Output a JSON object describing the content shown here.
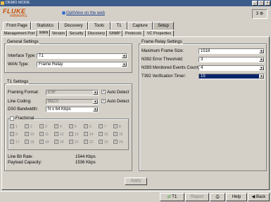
{
  "window": {
    "title": "DEMO MODE"
  },
  "header": {
    "brand_line1": "FLUKE",
    "brand_line2": "networks.",
    "web_link": "OptiView on the web",
    "counter": "3"
  },
  "main_tabs": [
    "Front Page",
    "Statistics",
    "Discovery",
    "Tools",
    "T1",
    "Capture",
    "Setup"
  ],
  "sub_tabs": [
    "Management Port",
    "WAN",
    "Version",
    "Security",
    "Discovery",
    "SNMP",
    "Protocols",
    "VC Properties"
  ],
  "general_settings": {
    "title": "General Settings",
    "interface_type_label": "Interface Type:",
    "interface_type_value": "T1",
    "wan_type_label": "WAN Type:",
    "wan_type_value": "Frame Relay"
  },
  "t1_settings": {
    "title": "T1 Settings",
    "framing_format_label": "Framing Format:",
    "framing_format_value": "ESF",
    "line_coding_label": "Line Coding:",
    "line_coding_value": "B8ZS",
    "ds0_bandwidth_label": "DS0 Bandwidth:",
    "ds0_bandwidth_value": "N x 64 Kbps",
    "auto_detect_label": "Auto Detect",
    "fractional_label": "Fractional",
    "channels": [
      "1",
      "2",
      "3",
      "4",
      "5",
      "6",
      "7",
      "8",
      "9",
      "10",
      "11",
      "12",
      "13",
      "14",
      "15",
      "16",
      "17",
      "18",
      "19",
      "20",
      "21",
      "22",
      "23",
      "24"
    ],
    "line_bit_rate_label": "Line Bit Rate:",
    "line_bit_rate_value": "1544 Kbps",
    "payload_capacity_label": "Payload Capacity:",
    "payload_capacity_value": "1536 Kbps"
  },
  "frame_relay": {
    "title": "Frame Relay Settings",
    "max_frame_size_label": "Maximum Frame Size:",
    "max_frame_size_value": "1518",
    "n392_label": "N392 Error Threshold:",
    "n392_value": "3",
    "n393_label": "N393 Monitored Events Count:",
    "n393_value": "4",
    "t392_label": "T392 Verification Timer:",
    "t392_value": "15"
  },
  "apply_label": "Apply",
  "statusbar": {
    "t1_label": "T1",
    "report_label": "Report",
    "help_label": "Help",
    "back_label": "Back"
  },
  "colors": {
    "titlebar": "#3b5b8b",
    "brand": "#c84a00",
    "panel": "#d4d0c8",
    "highlight": "#0a246a"
  }
}
